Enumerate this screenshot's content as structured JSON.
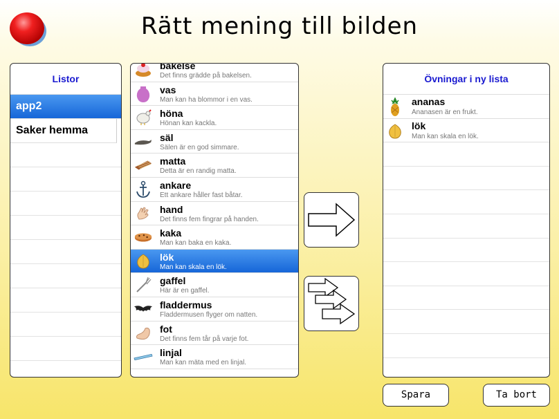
{
  "title": "Rätt mening till bilden",
  "lists_panel": {
    "header": "Listor",
    "items": [
      {
        "label": "app2",
        "selected": true
      },
      {
        "label": "Saker hemma",
        "selected": false
      }
    ]
  },
  "words_panel": {
    "items": [
      {
        "word": "bakelse",
        "sentence": "Det finns grädde på bakelsen.",
        "icon": "pastry-icon"
      },
      {
        "word": "vas",
        "sentence": "Man kan ha blommor i en vas.",
        "icon": "vase-icon"
      },
      {
        "word": "höna",
        "sentence": "Hönan kan kackla.",
        "icon": "hen-icon"
      },
      {
        "word": "säl",
        "sentence": "Sälen är en god simmare.",
        "icon": "seal-icon"
      },
      {
        "word": "matta",
        "sentence": "Detta är en randig matta.",
        "icon": "rug-icon"
      },
      {
        "word": "ankare",
        "sentence": "Ett ankare håller fast båtar.",
        "icon": "anchor-icon"
      },
      {
        "word": "hand",
        "sentence": "Det finns fem fingrar på handen.",
        "icon": "hand-icon"
      },
      {
        "word": "kaka",
        "sentence": "Man kan baka en kaka.",
        "icon": "cookie-icon"
      },
      {
        "word": "lök",
        "sentence": "Man kan skala en lök.",
        "icon": "onion-icon",
        "selected": true
      },
      {
        "word": "gaffel",
        "sentence": "Här är en gaffel.",
        "icon": "fork-icon"
      },
      {
        "word": "fladdermus",
        "sentence": "Fladdermusen flyger om natten.",
        "icon": "bat-icon"
      },
      {
        "word": "fot",
        "sentence": "Det finns fem tår på varje fot.",
        "icon": "foot-icon"
      },
      {
        "word": "linjal",
        "sentence": "Man kan mäta med en linjal.",
        "icon": "ruler-icon"
      }
    ]
  },
  "exercises_panel": {
    "header": "Övningar i ny lista",
    "items": [
      {
        "word": "ananas",
        "sentence": "Ananasen är en frukt.",
        "icon": "pineapple-icon"
      },
      {
        "word": "lök",
        "sentence": "Man kan skala en lök.",
        "icon": "onion-icon"
      }
    ]
  },
  "buttons": {
    "add_one": "arrow-right-icon",
    "add_all": "triple-arrow-icon",
    "save": "Spara",
    "delete": "Ta bort"
  },
  "colors": {
    "selection": "#1666d8",
    "header_text": "#1a1ad0"
  }
}
